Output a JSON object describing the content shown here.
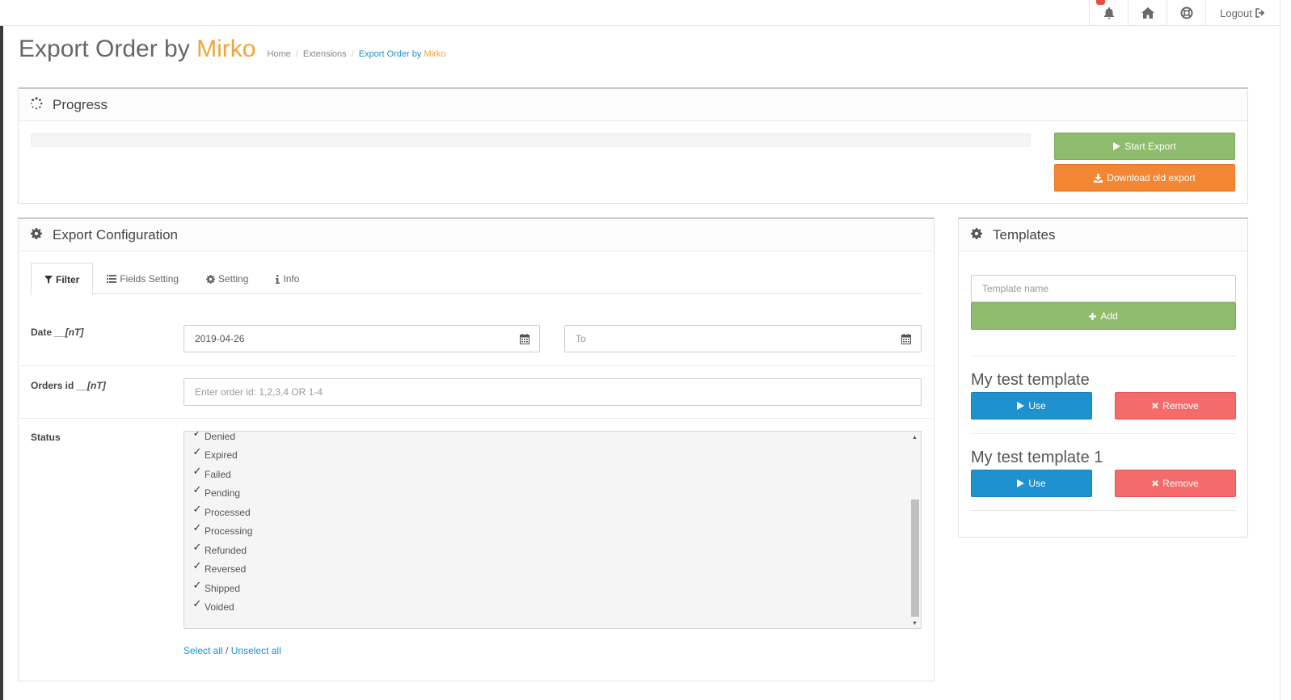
{
  "topbar": {
    "notification_icon": "bell-icon",
    "home_icon": "home-icon",
    "help_icon": "life-ring-icon",
    "logout_label": "Logout",
    "logout_icon": "sign-out-icon"
  },
  "header": {
    "title_main": "Export Order by",
    "title_accent": "Mirko",
    "breadcrumb": {
      "home": "Home",
      "extensions": "Extensions",
      "current_main": "Export Order by",
      "current_accent": "Mirko"
    }
  },
  "progress": {
    "heading": "Progress",
    "heading_icon": "spinner-icon",
    "percent": 0,
    "start_label": "Start Export",
    "download_label": "Download old export"
  },
  "config": {
    "heading": "Export Configuration",
    "heading_icon": "gear-icon",
    "tabs": [
      {
        "label": "Filter",
        "icon": "filter-icon",
        "active": true
      },
      {
        "label": "Fields Setting",
        "icon": "list-icon",
        "active": false
      },
      {
        "label": "Setting",
        "icon": "gear-icon",
        "active": false
      },
      {
        "label": "Info",
        "icon": "info-icon",
        "active": false
      }
    ],
    "date": {
      "label": "Date",
      "hint": "__[nT]",
      "from_value": "2019-04-26",
      "to_placeholder": "To"
    },
    "orders": {
      "label": "Orders id",
      "hint": "__[nT]",
      "placeholder": "Enter order id: 1,2,3,4 OR 1-4"
    },
    "status": {
      "label": "Status",
      "items": [
        {
          "label": "Denied",
          "checked": true
        },
        {
          "label": "Expired",
          "checked": true
        },
        {
          "label": "Failed",
          "checked": true
        },
        {
          "label": "Pending",
          "checked": true
        },
        {
          "label": "Processed",
          "checked": true
        },
        {
          "label": "Processing",
          "checked": true
        },
        {
          "label": "Refunded",
          "checked": true
        },
        {
          "label": "Reversed",
          "checked": true
        },
        {
          "label": "Shipped",
          "checked": true
        },
        {
          "label": "Voided",
          "checked": true
        }
      ],
      "select_all": "Select all",
      "separator": "/",
      "unselect_all": "Unselect all"
    }
  },
  "templates": {
    "heading": "Templates",
    "heading_icon": "gear-icon",
    "name_placeholder": "Template name",
    "add_label": "Add",
    "items": [
      {
        "name": "My test template",
        "use_label": "Use",
        "remove_label": "Remove"
      },
      {
        "name": "My test template 1",
        "use_label": "Use",
        "remove_label": "Remove"
      }
    ]
  },
  "colors": {
    "accent": "#f0a53b",
    "link": "#1e91cf",
    "success": "#8fbb6c",
    "warning": "#f38733",
    "danger": "#f56b6b"
  }
}
